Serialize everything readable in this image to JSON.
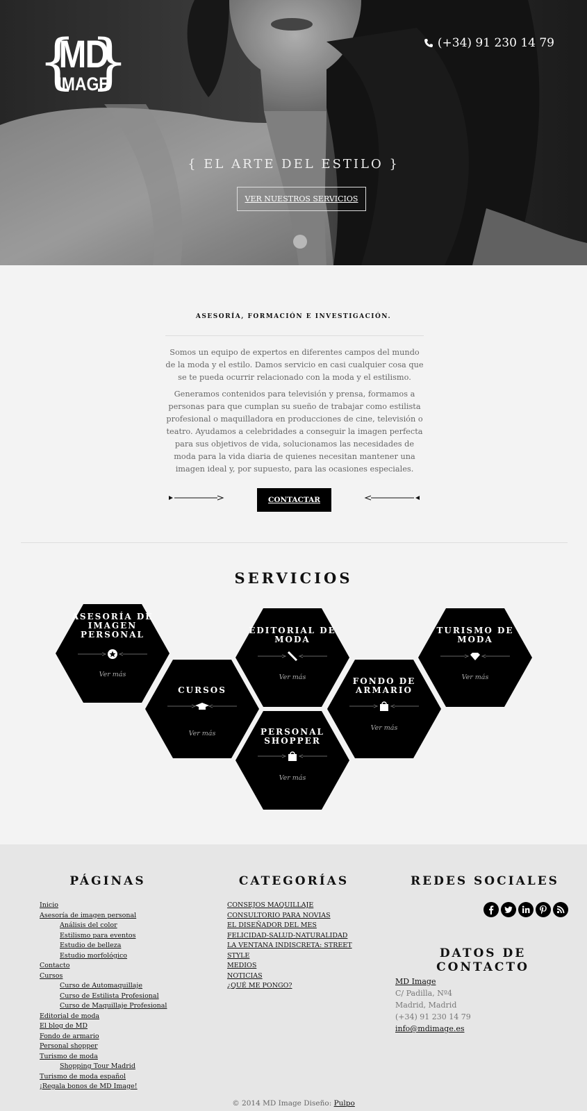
{
  "header": {
    "logo_top": "MD",
    "logo_bottom": "IMAGE",
    "phone": "(+34) 91 230 14 79",
    "tagline": "{ EL ARTE DEL ESTILO }",
    "cta": "VER NUESTROS SERVICIOS"
  },
  "intro": {
    "title": "ASESORÍA, FORMACIÓN E INVESTIGACIÓN.",
    "p1": "Somos un equipo de expertos en diferentes campos del mundo de la moda y el estilo. Damos servicio en casi cualquier cosa que se te pueda ocurrir relacionado con la moda y el estilismo.",
    "p2": "Generamos contenidos para televisión y prensa, formamos a personas para que cumplan su sueño de trabajar como estilista profesional o maquilladora en producciones de cine, televisión o teatro. Ayudamos a celebridades a conseguir la imagen perfecta para sus objetivos de vida, solucionamos las necesidades de moda para la vida diaria de quienes necesitan mantener una imagen ideal y, por supuesto, para las ocasiones especiales.",
    "button": "CONTACTAR"
  },
  "services": {
    "title": "SERVICIOS",
    "items": [
      {
        "title": "ASESORÍA DE IMAGEN PERSONAL",
        "more": "Ver más",
        "icon": "star-badge-icon"
      },
      {
        "title": "CURSOS",
        "more": "Ver más",
        "icon": "graduation-cap-icon"
      },
      {
        "title": "EDITORIAL DE MODA",
        "more": "Ver más",
        "icon": "pen-icon"
      },
      {
        "title": "PERSONAL SHOPPER",
        "more": "Ver más",
        "icon": "shopping-bag-icon"
      },
      {
        "title": "FONDO DE ARMARIO",
        "more": "Ver más",
        "icon": "shopping-bag-icon"
      },
      {
        "title": "TURISMO DE MODA",
        "more": "Ver más",
        "icon": "diamond-icon"
      }
    ]
  },
  "footer": {
    "pages_title": "PÁGINAS",
    "pages": [
      {
        "label": "Inicio",
        "sub": false
      },
      {
        "label": "Asesoría de imagen personal",
        "sub": false
      },
      {
        "label": "Análisis del color",
        "sub": true
      },
      {
        "label": "Estilismo para eventos",
        "sub": true
      },
      {
        "label": "Estudio de belleza",
        "sub": true
      },
      {
        "label": "Estudio morfológico",
        "sub": true
      },
      {
        "label": "Contacto",
        "sub": false
      },
      {
        "label": "Cursos",
        "sub": false
      },
      {
        "label": "Curso de Automaquillaje",
        "sub": true
      },
      {
        "label": "Curso de Estilista Profesional",
        "sub": true
      },
      {
        "label": "Curso de Maquillaje Profesional",
        "sub": true
      },
      {
        "label": "Editorial de moda",
        "sub": false
      },
      {
        "label": "El blog de MD",
        "sub": false
      },
      {
        "label": "Fondo de armario",
        "sub": false
      },
      {
        "label": "Personal shopper",
        "sub": false
      },
      {
        "label": "Turismo de moda",
        "sub": false
      },
      {
        "label": "Shopping Tour Madrid",
        "sub": true
      },
      {
        "label": "Turismo de moda español",
        "sub": false
      },
      {
        "label": "¡Regala bonos de MD Image!",
        "sub": false
      }
    ],
    "categories_title": "CATEGORÍAS",
    "categories": [
      "CONSEJOS MAQUILLAJE",
      "CONSULTORIO PARA NOVIAS",
      "EL DISEÑADOR DEL MES",
      "FELICIDAD-SALUD-NATURALIDAD",
      "LA VENTANA INDISCRETA: STREET STYLE",
      "MEDIOS",
      "NOTICIAS",
      "¿QUÉ ME PONGO?"
    ],
    "social_title": "REDES SOCIALES",
    "social": [
      "facebook-icon",
      "twitter-icon",
      "linkedin-icon",
      "pinterest-icon",
      "rss-icon"
    ],
    "contact_title": "DATOS DE CONTACTO",
    "contact": {
      "name": "MD Image",
      "street": "C/ Padilla, Nº4",
      "city": "Madrid, Madrid",
      "phone": "(+34) 91 230 14 79",
      "email": "info@mdimage.es"
    },
    "copyright": "© 2014 MD Image Diseño:",
    "credit": "Pulpo"
  }
}
